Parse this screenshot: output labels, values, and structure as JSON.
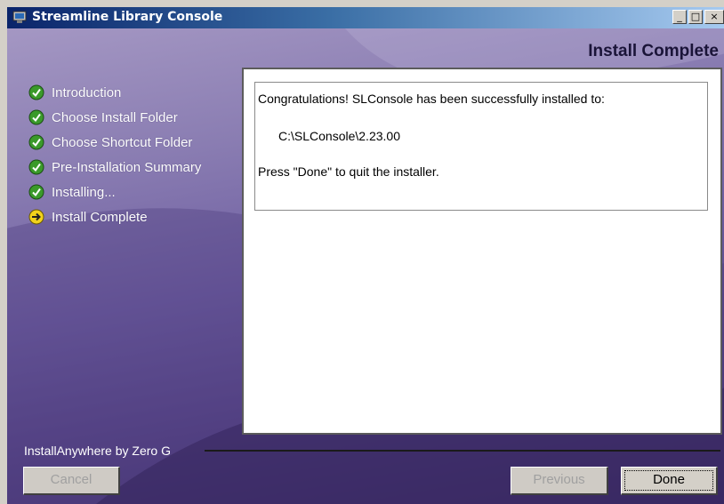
{
  "window": {
    "title": "Streamline Library Console",
    "minimize_glyph": "_",
    "maximize_glyph": "□",
    "close_glyph": "×"
  },
  "page": {
    "title": "Install Complete"
  },
  "steps": [
    {
      "label": "Introduction",
      "status": "complete"
    },
    {
      "label": "Choose Install Folder",
      "status": "complete"
    },
    {
      "label": "Choose Shortcut Folder",
      "status": "complete"
    },
    {
      "label": "Pre-Installation Summary",
      "status": "complete"
    },
    {
      "label": "Installing...",
      "status": "complete"
    },
    {
      "label": "Install Complete",
      "status": "current"
    }
  ],
  "message": {
    "line1": "Congratulations! SLConsole has been successfully installed to:",
    "install_path": "C:\\SLConsole\\2.23.00",
    "line3": "Press \"Done\" to quit the installer."
  },
  "footer": {
    "brand": "InstallAnywhere by Zero G"
  },
  "buttons": {
    "cancel": "Cancel",
    "previous": "Previous",
    "done": "Done"
  },
  "colors": {
    "title_bar_start": "#0a246a",
    "title_bar_end": "#a6caf0",
    "panel_bg": "#6e5ea1",
    "check_green": "#3a9a2a",
    "current_arrow_yellow": "#f2d21c"
  }
}
